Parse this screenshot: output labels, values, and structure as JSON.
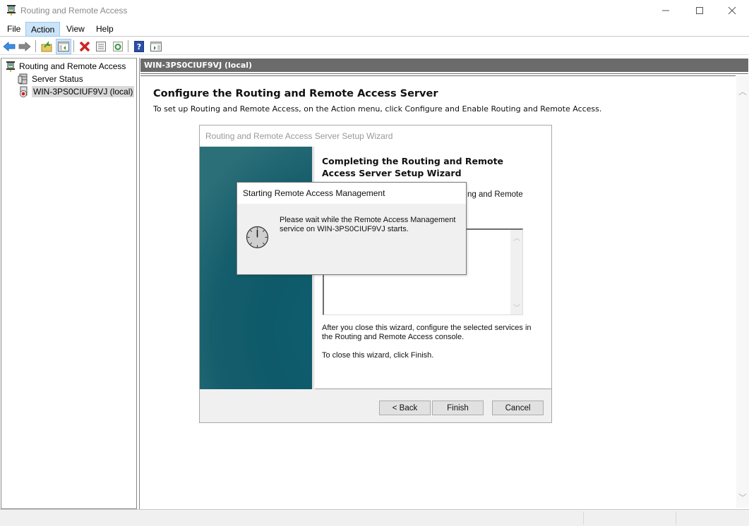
{
  "window": {
    "title": "Routing and Remote Access",
    "minimize_glyph": "—",
    "maximize_glyph": "☐",
    "close_glyph": "✕"
  },
  "menubar": {
    "items": [
      {
        "label": "File"
      },
      {
        "label": "Action",
        "active": true
      },
      {
        "label": "View"
      },
      {
        "label": "Help"
      }
    ]
  },
  "toolbar": {
    "buttons": [
      {
        "icon": "back-arrow-icon"
      },
      {
        "icon": "forward-arrow-icon"
      },
      {
        "icon": "up-folder-icon"
      },
      {
        "icon": "show-hide-console-tree-icon",
        "pressed": true
      },
      {
        "icon": "delete-icon"
      },
      {
        "icon": "properties-icon"
      },
      {
        "icon": "refresh-icon"
      },
      {
        "icon": "help-icon"
      },
      {
        "icon": "show-hide-action-pane-icon"
      }
    ]
  },
  "tree": {
    "items": [
      {
        "label": "Routing and Remote Access",
        "icon": "routing-console-icon",
        "level": 0
      },
      {
        "label": "Server Status",
        "icon": "server-status-icon",
        "level": 1
      },
      {
        "label": "WIN-3PS0CIUF9VJ (local)",
        "icon": "server-stopped-icon",
        "level": 1,
        "selected": true
      }
    ]
  },
  "main": {
    "header": "WIN-3PS0CIUF9VJ (local)",
    "title": "Configure the Routing and Remote Access Server",
    "description": "To set up Routing and Remote Access, on the Action menu, click Configure and Enable Routing and Remote Access."
  },
  "wizard": {
    "title": "Routing and Remote Access Server Setup Wizard",
    "heading": "Completing the Routing and Remote Access Server Setup Wizard",
    "partial_text": "ng and Remote",
    "after_text": "After you close this wizard, configure the selected services in the Routing and  Remote Access console.",
    "close_text": "To close this wizard, click Finish.",
    "buttons": {
      "back": "< Back",
      "finish": "Finish",
      "cancel": "Cancel"
    }
  },
  "modal": {
    "title": "Starting Remote Access Management",
    "message": "Please wait while the Remote Access Management service on WIN-3PS0CIUF9VJ starts."
  },
  "colors": {
    "header_bg": "#6b6b6b",
    "selection_bg": "#cce4f7",
    "banner_teal": "#0e5a6a"
  }
}
